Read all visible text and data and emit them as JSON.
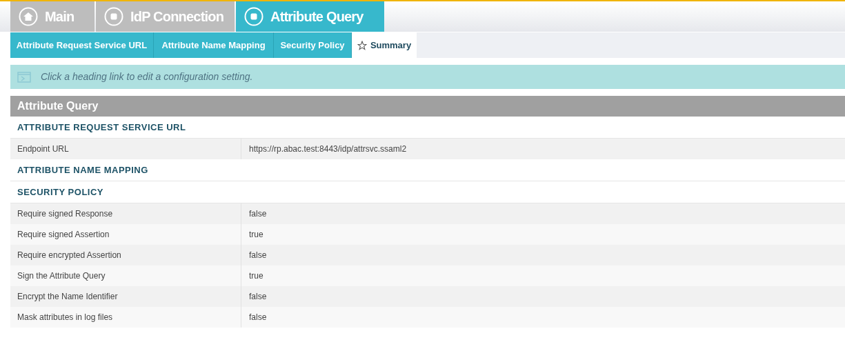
{
  "main_tabs": [
    {
      "label": "Main",
      "kind": "home",
      "selected": false
    },
    {
      "label": "IdP Connection",
      "kind": "step",
      "selected": false
    },
    {
      "label": "Attribute Query",
      "kind": "step",
      "selected": true
    }
  ],
  "sub_tabs": [
    {
      "label": "Attribute Request Service URL",
      "selected": false
    },
    {
      "label": "Attribute Name Mapping",
      "selected": false
    },
    {
      "label": "Security Policy",
      "selected": false
    },
    {
      "label": "Summary",
      "selected": true
    }
  ],
  "info": "Click a heading link to edit a configuration setting.",
  "panel": {
    "title": "Attribute Query",
    "sections": [
      {
        "heading": "ATTRIBUTE REQUEST SERVICE URL",
        "rows": [
          {
            "label": "Endpoint URL",
            "value": "https://rp.abac.test:8443/idp/attrsvc.ssaml2"
          }
        ]
      },
      {
        "heading": "ATTRIBUTE NAME MAPPING"
      },
      {
        "heading": "SECURITY POLICY",
        "rows": [
          {
            "label": "Require signed Response",
            "value": "false"
          },
          {
            "label": "Require signed Assertion",
            "value": "true"
          },
          {
            "label": "Require encrypted Assertion",
            "value": "false"
          },
          {
            "label": "Sign the Attribute Query",
            "value": "true"
          },
          {
            "label": "Encrypt the Name Identifier",
            "value": "false"
          },
          {
            "label": "Mask attributes in log files",
            "value": "false"
          }
        ]
      }
    ]
  }
}
